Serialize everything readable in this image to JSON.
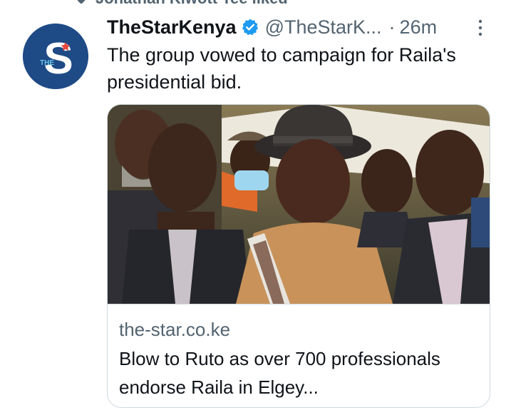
{
  "social_context": {
    "text": "Jonathan Kiwott Tee liked",
    "icon": "heart-icon"
  },
  "tweet": {
    "avatar_letter": "S",
    "avatar_tag": "THE",
    "display_name": "TheStarKenya",
    "handle": "@TheStarK...",
    "separator": "·",
    "time": "26m",
    "text": "The group vowed to campaign for Raila's presidential bid.",
    "colors": {
      "verified": "#1d9bf0",
      "avatar_bg": "#1e4a86",
      "secondary_text": "#536471"
    }
  },
  "card": {
    "image": "photo-group-of-men-outdoors",
    "domain": "the-star.co.ke",
    "title": "Blow to Ruto as over 700 professionals endorse Raila in Elgey..."
  }
}
